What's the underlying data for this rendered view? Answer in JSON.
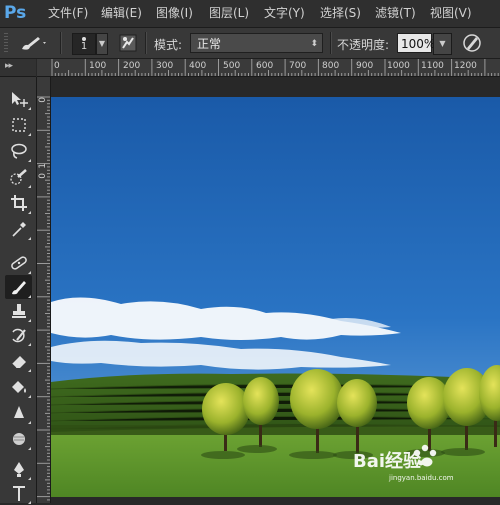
{
  "app": {
    "logo": "Ps"
  },
  "menu": {
    "items": [
      {
        "label": "文件(F)"
      },
      {
        "label": "编辑(E)"
      },
      {
        "label": "图像(I)"
      },
      {
        "label": "图层(L)"
      },
      {
        "label": "文字(Y)"
      },
      {
        "label": "选择(S)"
      },
      {
        "label": "滤镜(T)"
      },
      {
        "label": "视图(V)"
      }
    ]
  },
  "options": {
    "brush_size": "1",
    "mode_label": "模式:",
    "mode_value": "正常",
    "opacity_label": "不透明度:",
    "opacity_value": "100%"
  },
  "ruler": {
    "h_ticks": [
      "0",
      "100",
      "200",
      "300",
      "400",
      "500",
      "600",
      "700",
      "800",
      "900",
      "1000",
      "1100",
      "1200"
    ],
    "v_ticks": [
      "0",
      "1",
      "0"
    ]
  },
  "tools": [
    {
      "name": "move-tool-icon"
    },
    {
      "name": "marquee-tool-icon"
    },
    {
      "name": "lasso-tool-icon"
    },
    {
      "name": "quick-selection-tool-icon"
    },
    {
      "name": "crop-tool-icon"
    },
    {
      "name": "eyedropper-tool-icon"
    },
    {
      "name": "spot-healing-tool-icon"
    },
    {
      "name": "brush-tool-icon"
    },
    {
      "name": "clone-stamp-tool-icon"
    },
    {
      "name": "history-brush-tool-icon"
    },
    {
      "name": "eraser-tool-icon"
    },
    {
      "name": "paint-bucket-tool-icon"
    },
    {
      "name": "blur-tool-icon"
    },
    {
      "name": "dodge-tool-icon"
    },
    {
      "name": "pen-tool-icon"
    },
    {
      "name": "type-tool-icon"
    }
  ],
  "watermark": {
    "text": "Bai经验",
    "sub": "jingyan.baidu.com"
  },
  "colors": {
    "accent": "#5aa8ea",
    "sky_top": "#1b5fae",
    "grass": "#5b8e2a"
  }
}
